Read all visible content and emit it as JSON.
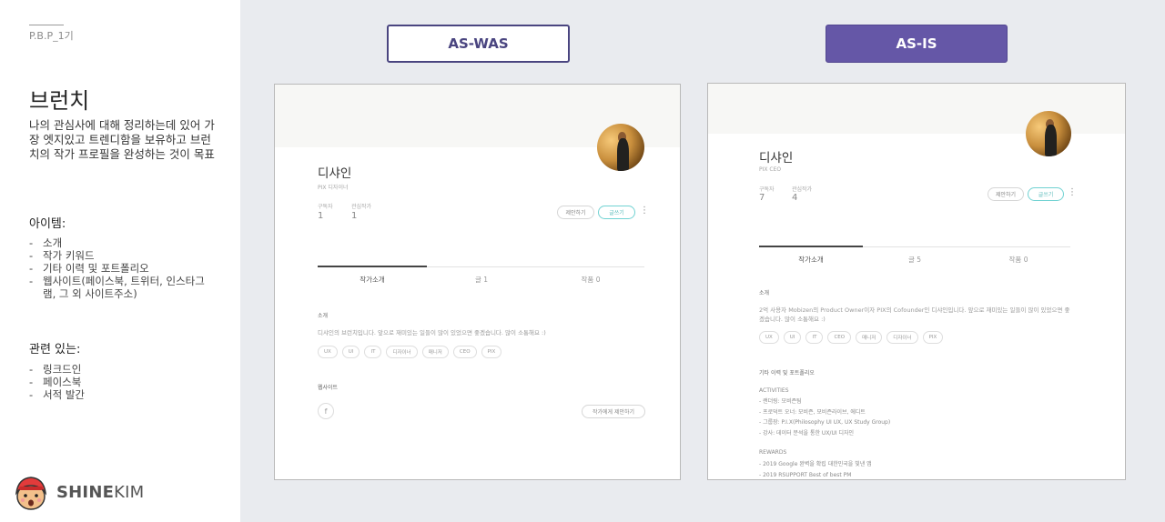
{
  "left": {
    "pbp": "P.B.P_1기",
    "title": "브런치",
    "description": "나의 관심사에 대해 정리하는데 있어 가장 엣지있고 트렌디함을 보유하고 브런치의 작가 프로필을 완성하는 것이 목표",
    "items_heading": "아이템:",
    "items": [
      "소개",
      "작가 키워드",
      "기타 이력 및 포트폴리오",
      "웹사이트(페이스북, 트위터, 인스타그램, 그 외 사이트주소)"
    ],
    "related_heading": "관련 있는:",
    "related": [
      "링크드인",
      "페이스북",
      "서적 발간"
    ],
    "logo_bold": "SHINE",
    "logo_light": "KIM"
  },
  "labels": {
    "aswas": "AS-WAS",
    "asis": "AS-IS"
  },
  "aswas": {
    "name": "디샤인",
    "role": "PIX 디자이너",
    "subscribers_label": "구독자",
    "subscribers": "1",
    "interest_label": "관심작가",
    "interest": "1",
    "suggest_button": "제안하기",
    "write_button": "글쓰기",
    "tabs": [
      "작가소개",
      "글 1",
      "작품 0"
    ],
    "intro_heading": "소개",
    "intro_text": "디샤인의 브런치입니다. 앞으로 재미있는 일들이 많이 있었으면 좋겠습니다. 많이 소통해요 :)",
    "tags": [
      "UX",
      "UI",
      "IT",
      "디자이너",
      "매니저",
      "CEO",
      "PIX"
    ],
    "website_heading": "웹사이트",
    "facebook_glyph": "f",
    "suggest_author_button": "작가에게 제안하기"
  },
  "asis": {
    "name": "디샤인",
    "role": "PIX CEO",
    "subscribers_label": "구독자",
    "subscribers": "7",
    "interest_label": "관심작가",
    "interest": "4",
    "suggest_button": "제안하기",
    "write_button": "글쓰기",
    "tabs": [
      "작가소개",
      "글 5",
      "작품 0"
    ],
    "intro_heading": "소개",
    "intro_text": "2억 사용자 Mobizen의 Product Owner이자 PIX의 Cofounder인 디샤인입니다. 앞으로 재미있는 일들이 많이 있었으면 좋겠습니다. 많이 소통해요 :)",
    "tags": [
      "UX",
      "UI",
      "IT",
      "CEO",
      "매니저",
      "디자이너",
      "PIX"
    ],
    "history_heading": "기타 이력 및 포트폴리오",
    "activities_heading": "ACTIVITIES",
    "activities": [
      "- 랜더링: 모비즌팀",
      "- 프로덕트 오너: 모비즌, 모비즌라이브, 에디트",
      "- 그룹장: P.I.X(Philosophy UI UX, UX Study Group)",
      "- 강사: 데이터 분석을 통한 UX/UI 디자인"
    ],
    "rewards_heading": "REWARDS",
    "rewards": [
      "- 2019 Google 완벽을 확립 대한민국을 빛낸 앱",
      "- 2019 RSUPPORT Best of best PM"
    ]
  }
}
